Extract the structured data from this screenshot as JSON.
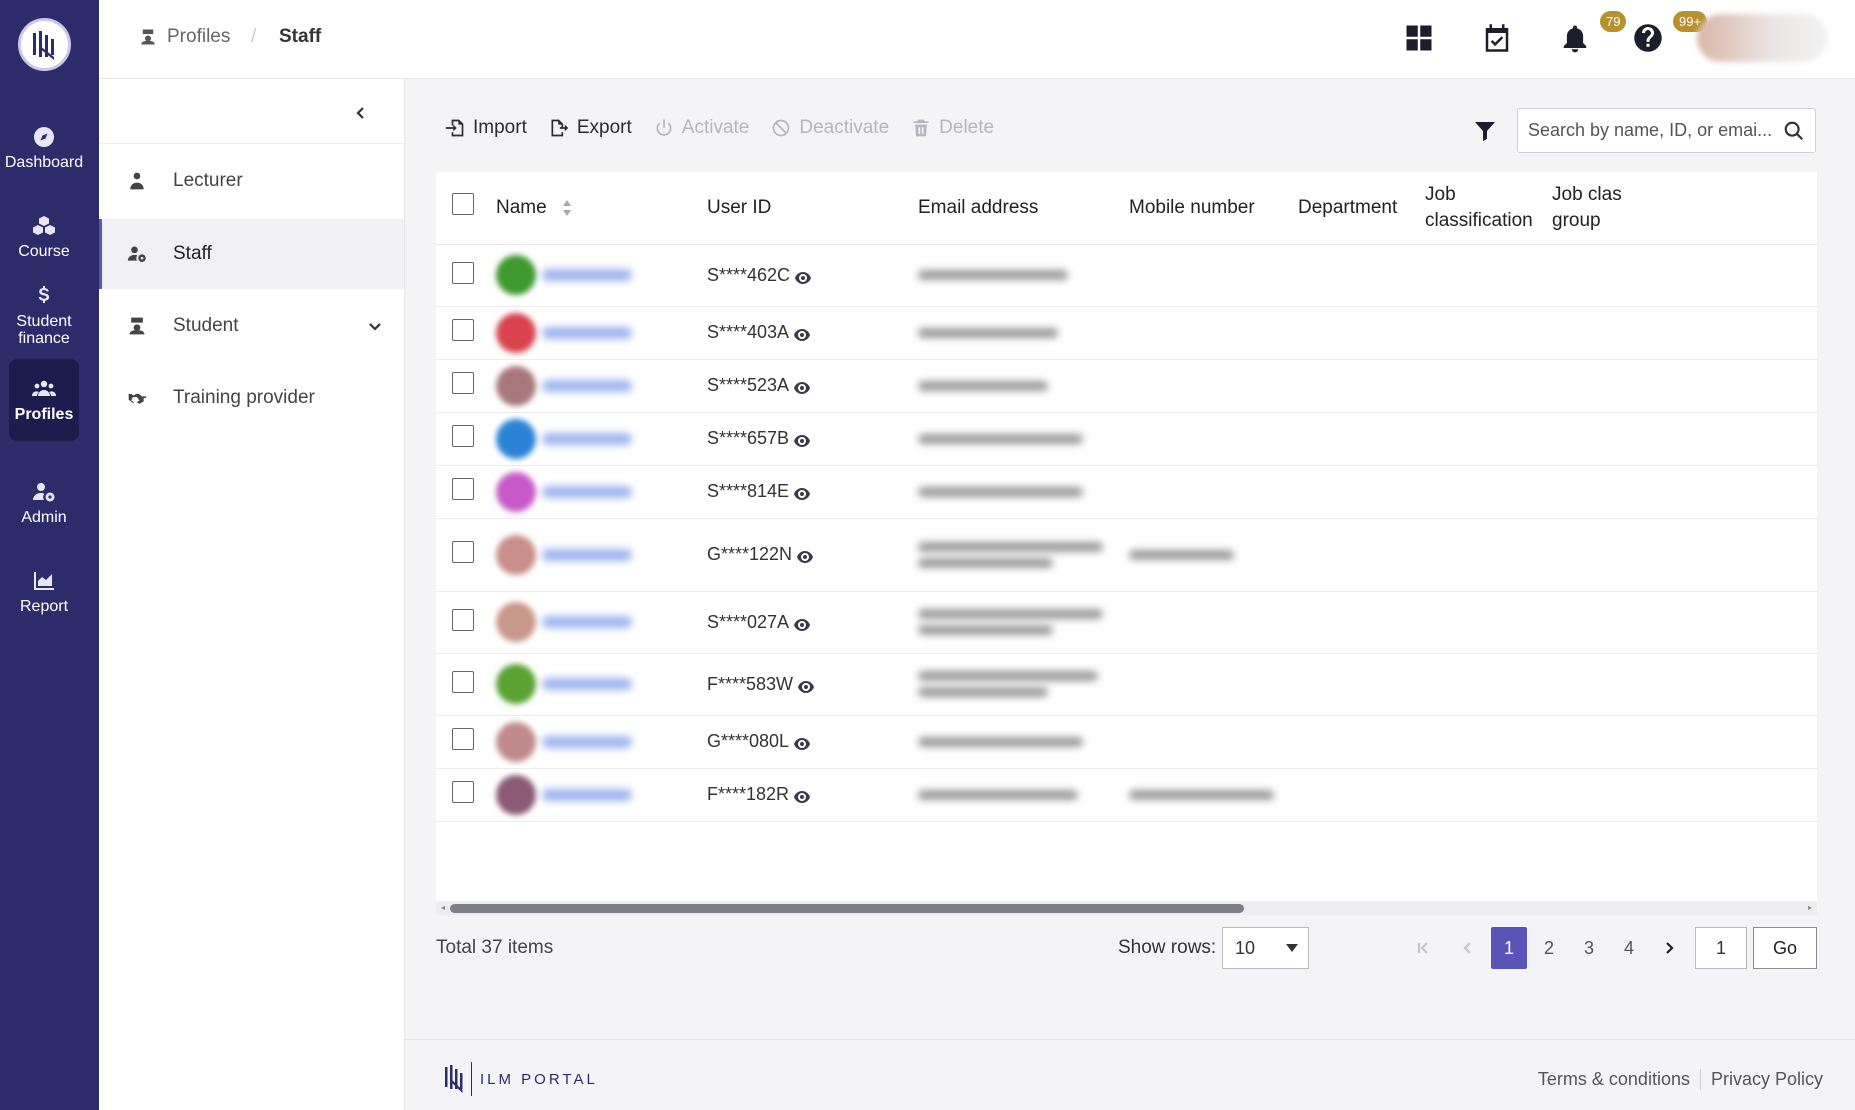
{
  "nav": {
    "items": [
      {
        "label": "Dashboard",
        "icon": "compass-icon"
      },
      {
        "label": "Course",
        "icon": "cubes-icon"
      },
      {
        "label": "Student finance",
        "icon": "dollar-icon"
      },
      {
        "label": "Profiles",
        "icon": "users-icon"
      },
      {
        "label": "Admin",
        "icon": "user-gear-icon"
      },
      {
        "label": "Report",
        "icon": "chart-area-icon"
      }
    ]
  },
  "header": {
    "breadcrumb": [
      "Profiles",
      "Staff"
    ],
    "breadcrumb_separator": "/",
    "tasks_badge": "79",
    "notifications_badge": "99+"
  },
  "subnav": {
    "items": [
      {
        "label": "Lecturer"
      },
      {
        "label": "Staff"
      },
      {
        "label": "Student"
      },
      {
        "label": "Training provider"
      }
    ]
  },
  "toolbar": {
    "import": "Import",
    "export": "Export",
    "activate": "Activate",
    "deactivate": "Deactivate",
    "delete": "Delete",
    "search_placeholder": "Search by name, ID, or emai..."
  },
  "table": {
    "columns": [
      "Name",
      "User ID",
      "Email address",
      "Mobile number",
      "Department",
      "Job classification",
      "Job classification group"
    ],
    "columns_visible": [
      "Name",
      "User ID",
      "Email address",
      "Mobile number",
      "Department",
      "Job\nclassification",
      "Job clas\ngroup"
    ],
    "rows": [
      {
        "user_id": "S****462C"
      },
      {
        "user_id": "S****403A"
      },
      {
        "user_id": "S****523A"
      },
      {
        "user_id": "S****657B"
      },
      {
        "user_id": "S****814E"
      },
      {
        "user_id": "G****122N"
      },
      {
        "user_id": "S****027A"
      },
      {
        "user_id": "F****583W"
      },
      {
        "user_id": "G****080L"
      },
      {
        "user_id": "F****182R"
      }
    ]
  },
  "pagination": {
    "total": "Total 37 items",
    "show_rows_label": "Show rows:",
    "rows_value": "10",
    "pages": [
      "1",
      "2",
      "3",
      "4"
    ],
    "current_page": "1",
    "goto_value": "1",
    "go_label": "Go"
  },
  "footer": {
    "brand": "ILM PORTAL",
    "terms": "Terms & conditions",
    "privacy": "Privacy Policy"
  },
  "colors": {
    "rail": "#2e2b6b",
    "accent": "#5a54b8",
    "badge": "#b6912d"
  }
}
